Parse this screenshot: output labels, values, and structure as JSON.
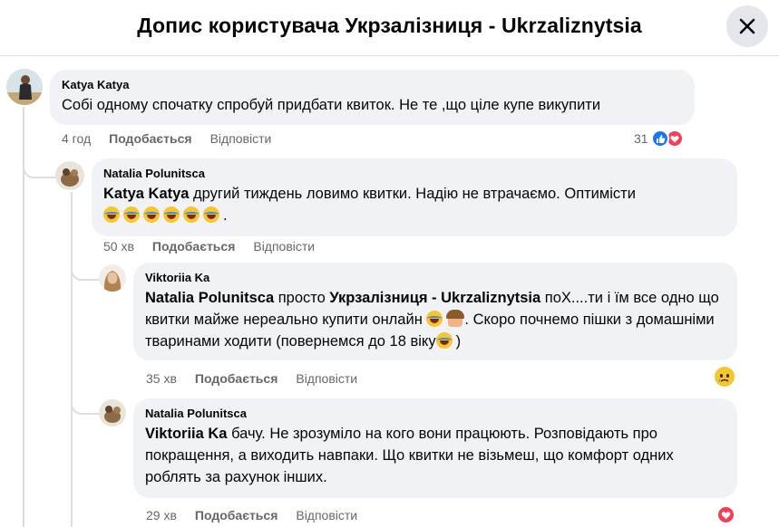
{
  "header": {
    "title": "Допис користувача Укрзалізниця - Ukrzaliznytsia",
    "close_icon": "close-icon"
  },
  "comments": [
    {
      "author": "Katya Katya",
      "text": "Собі одному спочатку спробуй придбати квиток. Не те ,що ціле купе викупити",
      "time": "4 год",
      "like": "Подобається",
      "reply": "Відповісти",
      "reaction_count": "31",
      "reactions": [
        "like-icon",
        "love-icon"
      ]
    },
    {
      "author": "Natalia Polunitsca",
      "mention": "Katya Katya",
      "text": " другий тиждень ловимо квитки. Надію не втрачаємо. Оптимісти",
      "text_end": ".",
      "time": "50 хв",
      "like": "Подобається",
      "reply": "Відповісти"
    },
    {
      "author": "Viktoriia Ka",
      "mention": "Natalia Polunitsca",
      "text_a": " просто ",
      "mention2": "Укрзалізниця - Ukrzaliznytsia",
      "text_b": " поХ....ти і їм все одно що квитки майже нереально купити онлайн ",
      "text_c": ". Скоро почнемо пішки з домашніми тваринами ходити (повернемся до 18 віку",
      "text_d": ")",
      "time": "35 хв",
      "like": "Подобається",
      "reply": "Відповісти",
      "reactions": [
        "sad-icon"
      ]
    },
    {
      "author": "Natalia Polunitsca",
      "mention": "Viktoriia Ka",
      "text": " бачу. Не зрозуміло на кого вони працюють. Розповідають про покращення, а виходить навпаки. Що квитки не візьмеш, що комфорт одних роблять за рахунок інших.",
      "time": "29 хв",
      "like": "Подобається",
      "reply": "Відповісти",
      "reactions": [
        "love-icon"
      ]
    }
  ]
}
